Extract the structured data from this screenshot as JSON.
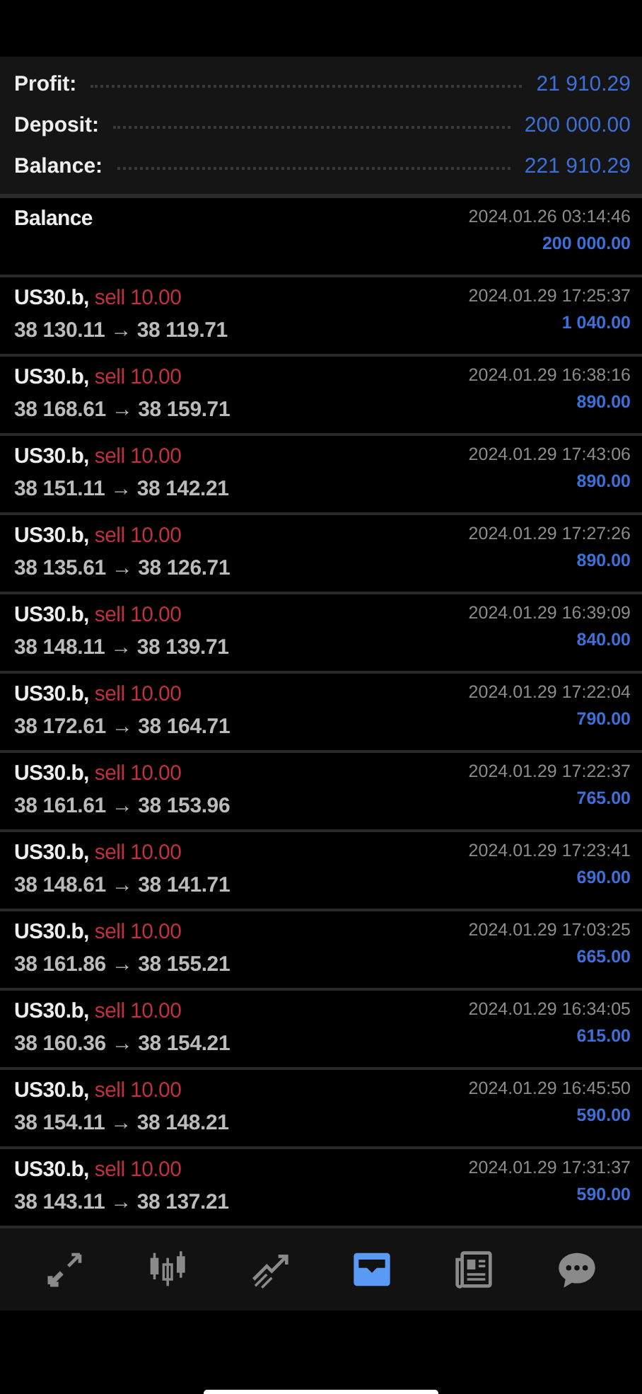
{
  "summary": [
    {
      "label": "Profit:",
      "value": "21 910.29"
    },
    {
      "label": "Deposit:",
      "value": "200 000.00"
    },
    {
      "label": "Balance:",
      "value": "221 910.29"
    }
  ],
  "balance_entry": {
    "label": "Balance",
    "time": "2024.01.26 03:14:46",
    "amount": "200 000.00"
  },
  "deals": [
    {
      "symbol": "US30.b,",
      "type": "sell 10.00",
      "prices": "38 130.11 → 38 119.71",
      "time": "2024.01.29 17:25:37",
      "profit": "1 040.00"
    },
    {
      "symbol": "US30.b,",
      "type": "sell 10.00",
      "prices": "38 168.61 → 38 159.71",
      "time": "2024.01.29 16:38:16",
      "profit": "890.00"
    },
    {
      "symbol": "US30.b,",
      "type": "sell 10.00",
      "prices": "38 151.11 → 38 142.21",
      "time": "2024.01.29 17:43:06",
      "profit": "890.00"
    },
    {
      "symbol": "US30.b,",
      "type": "sell 10.00",
      "prices": "38 135.61 → 38 126.71",
      "time": "2024.01.29 17:27:26",
      "profit": "890.00"
    },
    {
      "symbol": "US30.b,",
      "type": "sell 10.00",
      "prices": "38 148.11 → 38 139.71",
      "time": "2024.01.29 16:39:09",
      "profit": "840.00"
    },
    {
      "symbol": "US30.b,",
      "type": "sell 10.00",
      "prices": "38 172.61 → 38 164.71",
      "time": "2024.01.29 17:22:04",
      "profit": "790.00"
    },
    {
      "symbol": "US30.b,",
      "type": "sell 10.00",
      "prices": "38 161.61 → 38 153.96",
      "time": "2024.01.29 17:22:37",
      "profit": "765.00"
    },
    {
      "symbol": "US30.b,",
      "type": "sell 10.00",
      "prices": "38 148.61 → 38 141.71",
      "time": "2024.01.29 17:23:41",
      "profit": "690.00"
    },
    {
      "symbol": "US30.b,",
      "type": "sell 10.00",
      "prices": "38 161.86 → 38 155.21",
      "time": "2024.01.29 17:03:25",
      "profit": "665.00"
    },
    {
      "symbol": "US30.b,",
      "type": "sell 10.00",
      "prices": "38 160.36 → 38 154.21",
      "time": "2024.01.29 16:34:05",
      "profit": "615.00"
    },
    {
      "symbol": "US30.b,",
      "type": "sell 10.00",
      "prices": "38 154.11 → 38 148.21",
      "time": "2024.01.29 16:45:50",
      "profit": "590.00"
    },
    {
      "symbol": "US30.b,",
      "type": "sell 10.00",
      "prices": "38 143.11 → 38 137.21",
      "time": "2024.01.29 17:31:37",
      "profit": "590.00"
    }
  ],
  "tabs": [
    {
      "selected": false
    },
    {
      "selected": false
    },
    {
      "selected": false
    },
    {
      "selected": true
    },
    {
      "selected": false
    },
    {
      "selected": false
    }
  ]
}
